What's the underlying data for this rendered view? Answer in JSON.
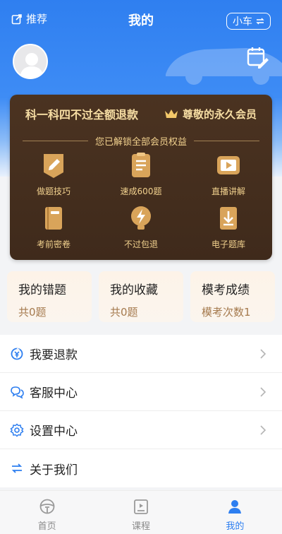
{
  "header": {
    "recommend_label": "推荐",
    "title": "我的",
    "vehicle_switch_label": "小车"
  },
  "vip_card": {
    "slogan": "科一科四不过全额退款",
    "level": "尊敬的永久会员",
    "unlock_text": "您已解锁全部会员权益",
    "perks": [
      {
        "label": "做题技巧",
        "icon": "pencil-icon"
      },
      {
        "label": "速成600题",
        "icon": "clipboard-icon"
      },
      {
        "label": "直播讲解",
        "icon": "video-play-icon"
      },
      {
        "label": "考前密卷",
        "icon": "book-icon"
      },
      {
        "label": "不过包退",
        "icon": "lightning-bulb-icon"
      },
      {
        "label": "电子题库",
        "icon": "download-book-icon"
      }
    ]
  },
  "stats": [
    {
      "title": "我的错题",
      "sub": "共0题"
    },
    {
      "title": "我的收藏",
      "sub": "共0题"
    },
    {
      "title": "模考成绩",
      "sub": "模考次数1"
    }
  ],
  "menu": [
    {
      "label": "我要退款",
      "icon": "refund-icon"
    },
    {
      "label": "客服中心",
      "icon": "chat-icon"
    },
    {
      "label": "设置中心",
      "icon": "gear-icon"
    },
    {
      "label": "关于我们",
      "icon": "swap-icon"
    }
  ],
  "tabbar": [
    {
      "label": "首页",
      "icon": "steering-wheel-icon",
      "active": false
    },
    {
      "label": "课程",
      "icon": "course-icon",
      "active": false
    },
    {
      "label": "我的",
      "icon": "user-icon",
      "active": true
    }
  ],
  "colors": {
    "primary_blue": "#2d7ef0",
    "vip_brown": "#3f2a1b",
    "vip_gold": "#f1d18e"
  }
}
